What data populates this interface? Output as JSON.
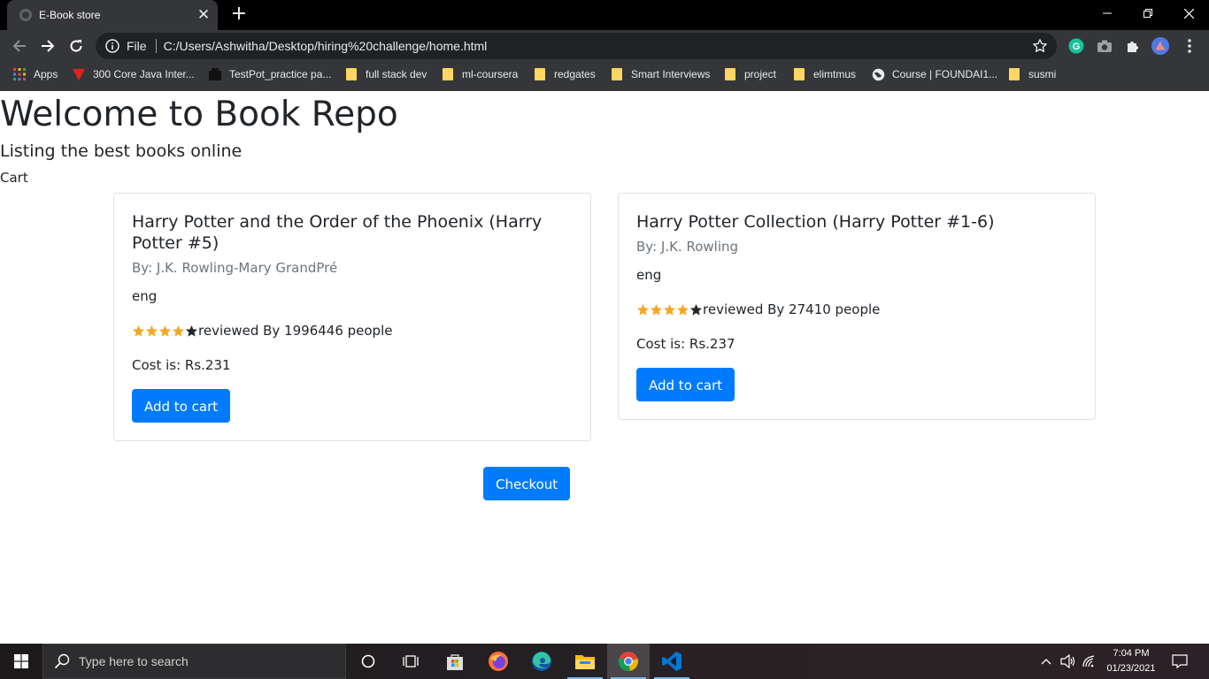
{
  "browser": {
    "tab_title": "E-Book store",
    "tab_close": "✕",
    "new_tab": "+",
    "scheme_label": "File",
    "url": "C:/Users/Ashwitha/Desktop/hiring%20challenge/home.html",
    "bookmarks": [
      {
        "label": "Apps",
        "icon": "apps-grid-icon"
      },
      {
        "label": "300 Core Java Inter...",
        "icon": "red-v-icon"
      },
      {
        "label": "TestPot_practice pa...",
        "icon": "black-box-icon"
      },
      {
        "label": "full stack dev",
        "icon": "folder-icon"
      },
      {
        "label": "ml-coursera",
        "icon": "folder-icon"
      },
      {
        "label": "redgates",
        "icon": "folder-icon"
      },
      {
        "label": "Smart Interviews",
        "icon": "folder-icon"
      },
      {
        "label": "project",
        "icon": "folder-icon"
      },
      {
        "label": "elimtmus",
        "icon": "folder-icon"
      },
      {
        "label": "Course | FOUNDAI1...",
        "icon": "globe-icon"
      },
      {
        "label": "susmi",
        "icon": "folder-icon"
      }
    ]
  },
  "page": {
    "title": "Welcome to Book Repo",
    "subtitle": "Listing the best books online",
    "cart_label": "Cart",
    "checkout_label": "Checkout",
    "books": [
      {
        "title": "Harry Potter and the Order of the Phoenix (Harry Potter #5)",
        "author": "By: J.K. Rowling-Mary GrandPré",
        "language": "eng",
        "stars_filled": 4,
        "stars_total": 5,
        "reviews": "reviewed By 1996446 people",
        "cost": "Cost is: Rs.231",
        "button": "Add to cart"
      },
      {
        "title": "Harry Potter Collection (Harry Potter #1-6)",
        "author": "By: J.K. Rowling",
        "language": "eng",
        "stars_filled": 4,
        "stars_total": 5,
        "reviews": "reviewed By 27410 people",
        "cost": "Cost is: Rs.237",
        "button": "Add to cart"
      }
    ]
  },
  "taskbar": {
    "search_placeholder": "Type here to search",
    "time": "7:04 PM",
    "date": "01/23/2021"
  },
  "colors": {
    "primary": "#007bff",
    "star": "#f5a623",
    "star_empty": "#212529"
  }
}
